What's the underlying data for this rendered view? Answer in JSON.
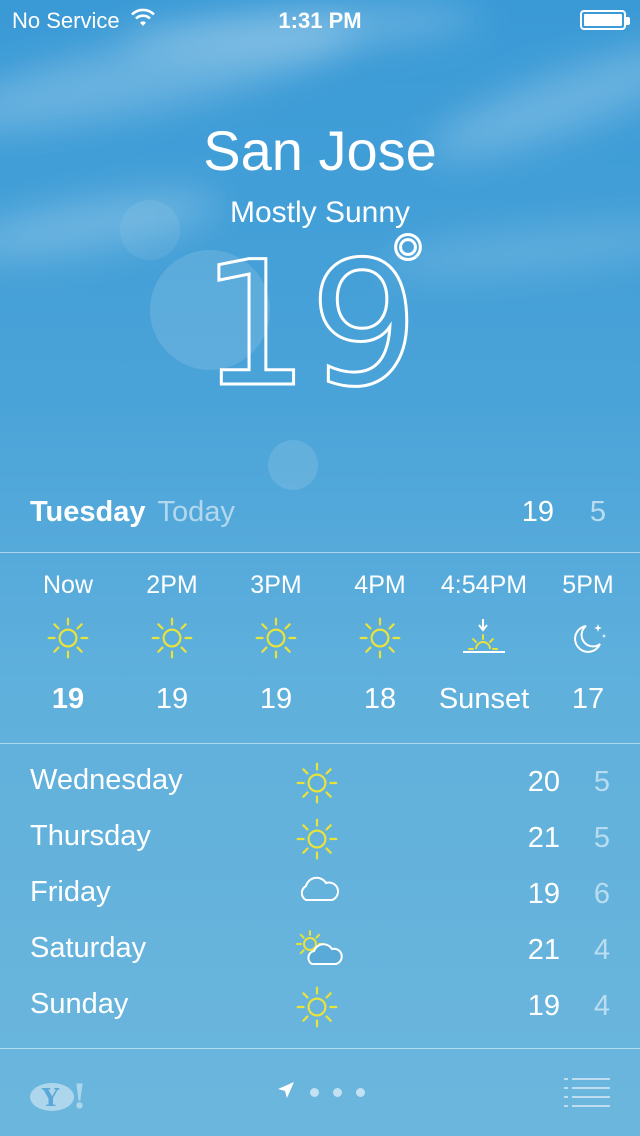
{
  "status_bar": {
    "carrier": "No Service",
    "time": "1:31 PM"
  },
  "hero": {
    "city": "San Jose",
    "condition": "Mostly Sunny",
    "temperature": "19",
    "degree": "°"
  },
  "today": {
    "day": "Tuesday",
    "label": "Today",
    "high": "19",
    "low": "5"
  },
  "hourly": [
    {
      "time": "Now",
      "icon": "sun-icon",
      "temp": "19",
      "bold": true
    },
    {
      "time": "2PM",
      "icon": "sun-icon",
      "temp": "19"
    },
    {
      "time": "3PM",
      "icon": "sun-icon",
      "temp": "19"
    },
    {
      "time": "4PM",
      "icon": "sun-icon",
      "temp": "18"
    },
    {
      "time": "4:54PM",
      "icon": "sunset-icon",
      "temp": "Sunset"
    },
    {
      "time": "5PM",
      "icon": "moon-icon",
      "temp": "17"
    }
  ],
  "daily": [
    {
      "day": "Wednesday",
      "icon": "sun-icon",
      "high": "20",
      "low": "5"
    },
    {
      "day": "Thursday",
      "icon": "sun-icon",
      "high": "21",
      "low": "5"
    },
    {
      "day": "Friday",
      "icon": "cloud-icon",
      "high": "19",
      "low": "6"
    },
    {
      "day": "Saturday",
      "icon": "partly-cloudy-icon",
      "high": "21",
      "low": "4"
    },
    {
      "day": "Sunday",
      "icon": "sun-icon",
      "high": "19",
      "low": "4"
    }
  ],
  "colors": {
    "sun_yellow": "#e8e23a",
    "sky_blue": "#3a9ad6"
  }
}
